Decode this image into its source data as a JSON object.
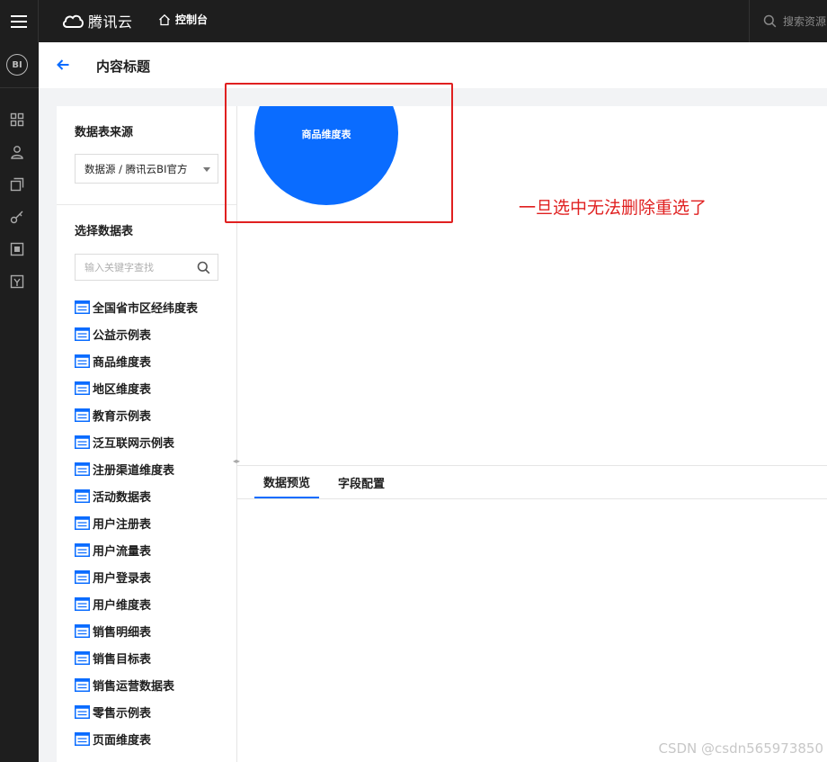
{
  "topbar": {
    "brand": "腾讯云",
    "console_label": "控制台",
    "search_placeholder": "搜索资源"
  },
  "rail": {
    "logo_text": "BI",
    "icons": [
      "dashboard-grid-icon",
      "user-icon",
      "layers-icon",
      "key-icon",
      "square-box-icon",
      "package-icon"
    ]
  },
  "header": {
    "title": "内容标题"
  },
  "panel": {
    "source_title": "数据表来源",
    "source_value": "数据源 / 腾讯云BI官方",
    "table_title": "选择数据表",
    "search_placeholder": "输入关键字查找",
    "tables": [
      "全国省市区经纬度表",
      "公益示例表",
      "商品维度表",
      "地区维度表",
      "教育示例表",
      "泛互联网示例表",
      "注册渠道维度表",
      "活动数据表",
      "用户注册表",
      "用户流量表",
      "用户登录表",
      "用户维度表",
      "销售明细表",
      "销售目标表",
      "销售运营数据表",
      "零售示例表",
      "页面维度表"
    ]
  },
  "canvas": {
    "node_label": "商品维度表"
  },
  "tabs": {
    "preview": "数据预览",
    "fields": "字段配置"
  },
  "annotation": {
    "note": "一旦选中无法删除重选了"
  },
  "watermark": "CSDN @csdn565973850",
  "colors": {
    "accent": "#0a6cff",
    "annotation": "#e02020",
    "topbar": "#1e1e1e"
  }
}
